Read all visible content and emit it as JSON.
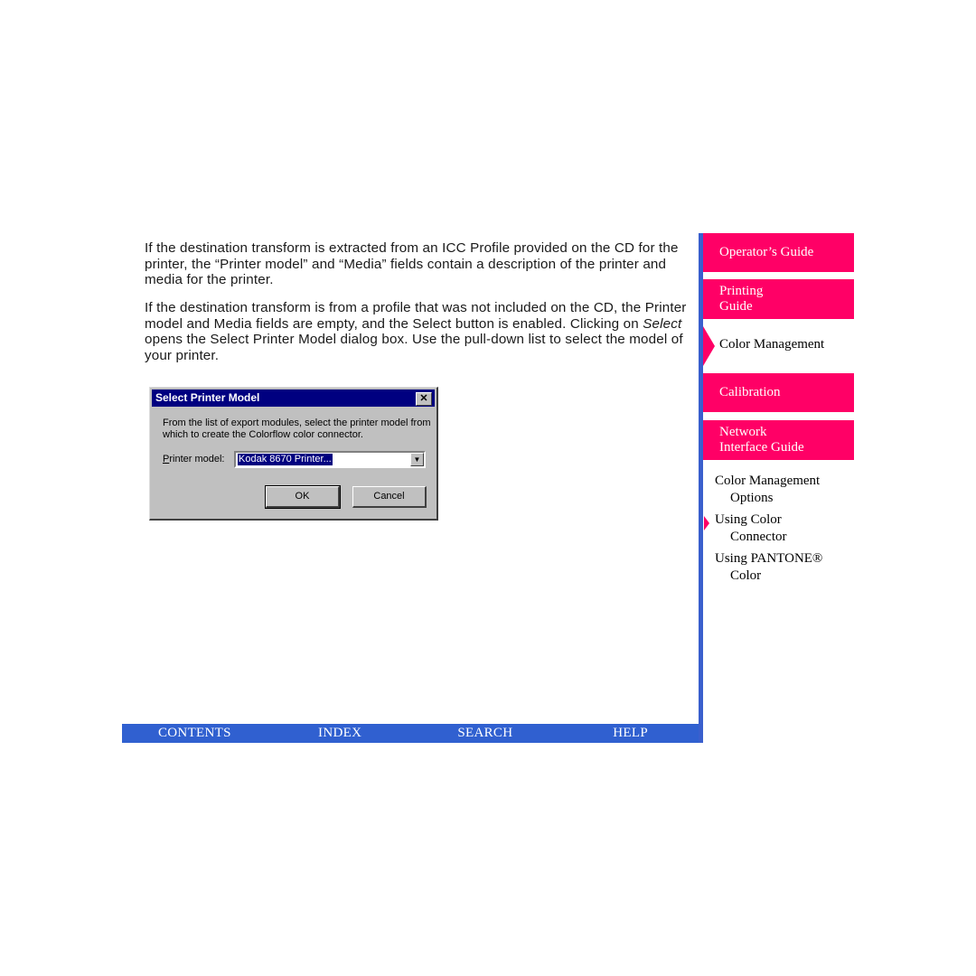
{
  "content": {
    "paragraph1": "If the destination transform is extracted from an ICC Profile provided on the CD for the printer, the “Printer model” and “Media” fields contain a description of the printer and media for the printer.",
    "paragraph2_before": "If the destination transform is from a profile that was not included on the CD, the Printer model and Media fields are empty, and the Select button is enabled. Clicking on ",
    "paragraph2_em": "Select",
    "paragraph2_after": " opens the Select Printer Model dialog box. Use the pull-down list to select the model of your printer."
  },
  "dialog": {
    "title": "Select Printer Model",
    "close_glyph": "✕",
    "message": "From the list of export modules, select the printer model from which to create the Colorflow color connector.",
    "label_mnemonic": "P",
    "label_rest": "rinter model:",
    "selected_value": "Kodak 8670 Printer...",
    "dropdown_glyph": "▼",
    "ok_label": "OK",
    "cancel_label": "Cancel"
  },
  "footer": {
    "items": [
      "CONTENTS",
      "INDEX",
      "SEARCH",
      "HELP"
    ]
  },
  "nav": {
    "guides": [
      {
        "line1": "Operator’s Guide",
        "line2": ""
      },
      {
        "line1": "Printing",
        "line2": "Guide"
      },
      {
        "line1": "Calibration",
        "line2": ""
      },
      {
        "line1": "Network",
        "line2": "Interface Guide"
      }
    ],
    "current_section": "Color Management",
    "sublinks": [
      {
        "line1": "Color Management",
        "line2": "Options"
      },
      {
        "line1": "Using Color",
        "line2": "Connector",
        "current": true
      },
      {
        "line1": "Using PANTONE®",
        "line2": "Color"
      }
    ],
    "colors": {
      "accent_pink": "#ff0066",
      "nav_blue": "#3060d0",
      "dialog_title": "#000080"
    }
  }
}
